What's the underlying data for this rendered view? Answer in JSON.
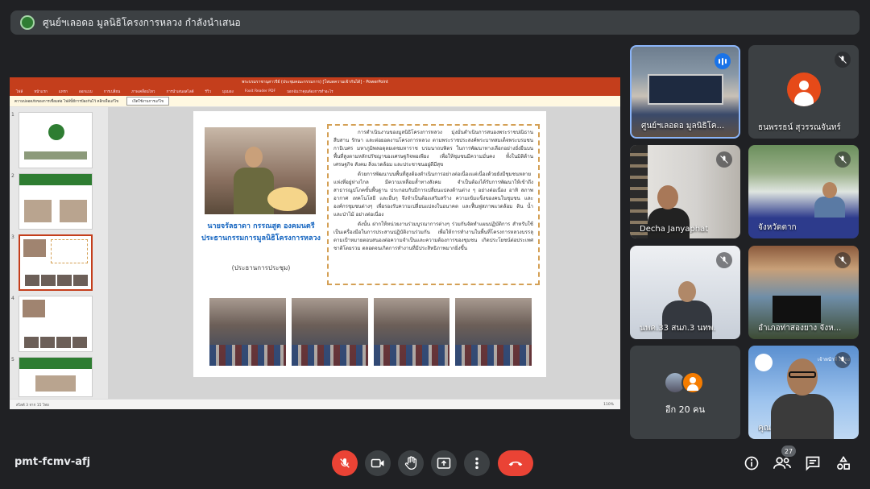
{
  "presenter_bar": {
    "text": "ศูนย์ฯเลอดอ มูลนิธิโครงการหลวง กำลังนำเสนอ"
  },
  "powerpoint": {
    "title": "พระบรมราชานุสาวรีย์ (ประชุมคณะกรรมการ) [โหมดความเข้ากันได้] - PowerPoint",
    "ribbon_tabs": [
      "ไฟล์",
      "หน้าแรก",
      "แทรก",
      "ออกแบบ",
      "การเปลี่ยน",
      "ภาพเคลื่อนไหว",
      "การนำเสนอสไลด์",
      "รีวิว",
      "มุมมอง",
      "Foxit Reader PDF",
      "บอกฉันว่าคุณต้องการทำอะไร"
    ],
    "message": "ความปลอดภัยของการเชื่อมต่อ  ไฟล์นี้มีการป้องกันไว้ คลิกเพื่อแก้ไข",
    "message_button": "เปิดใช้งานการแก้ไข",
    "thumb_numbers": [
      "1",
      "2",
      "3",
      "4",
      "5"
    ],
    "status_left": "สไลด์ 3 จาก 15   ไทย",
    "status_right": "110%",
    "slide": {
      "person_name": "นายจรัลธาดา กรรณสูต องคมนตรี ประธานกรรมการมูลนิธิโครงการหลวง",
      "caption": "(ประธานการประชุม)",
      "paragraphs": [
        "การดำเนินงานของมูลนิธิโครงการหลวง มุ่งมั่นดำเนินการสนองพระราชปณิธาน สืบสาน รักษา และต่อยอดงานโครงการหลวง ตามพระราชประสงค์พระบาทสมเด็จพระบรมชนกาธิเบศร มหาภูมิพลอดุลยเดชมหาราช บรมนาถบพิตร ในการพัฒนาทางเลือกอย่างยั่งยืนบนพื้นที่สูงตามหลักปรัชญาของเศรษฐกิจพอเพียง เพื่อให้ชุมชนมีความมั่นคง ทั้งในมิติด้านเศรษฐกิจ สังคม สิ่งแวดล้อม และประชาชนอยู่ดีมีสุข",
        "ด้วยการพัฒนาบนพื้นที่สูงต้องดำเนินการอย่างต่อเนื่องแต่เนื่องด้วยยังมีชุมชนหลายแห่งที่อยู่ห่างไกล มีความเหลื่อมล้ำทางสังคม จำเป็นต้องได้รับการพัฒนาให้เข้าถึงสาธารณูปโภคขั้นพื้นฐาน ประกอบกับมีการเปลี่ยนแปลงด้านต่าง ๆ อย่างต่อเนื่อง อาทิ สภาพอากาศ เทคโนโลยี และอื่นๆ จึงจำเป็นต้องเสริมสร้าง ความเข้มแข็งของคนในชุมชน และองค์กรชุมชนต่างๆ เพื่อรองรับความเปลี่ยนแปลงในอนาคต และฟื้นฟูสภาพแวดล้อม ดิน น้ำ และป่าไม้ อย่างต่อเนื่อง",
        "ดังนั้น ฝากให้หน่วยงานร่วมบูรณาการต่างๆ ร่วมกันจัดทำแผนปฏิบัติการ สำหรับใช้เป็นเครื่องมือในการประสานปฏิบัติงานร่วมกัน เพื่อให้การทำงานในพื้นที่โครงการหลวงบรรลุตามเป้าหมายตอบสนองต่อความจำเป็นและความต้องการของชุมชน เกิดประโยชน์ต่อประเทศชาติโดยรวม ตลอดจนเกิดการทำงานที่มีประสิทธิภาพมากยิ่งขึ้น"
      ]
    }
  },
  "participants": [
    {
      "name": "ศูนย์ฯเลอดอ มูลนิธิโค...",
      "state": "speaking"
    },
    {
      "name": "ธนพรรธน์ สุวรรณจันทร์",
      "state": "muted"
    },
    {
      "name": "Decha Janyaphat",
      "state": "muted"
    },
    {
      "name": "จังหวัดตาก",
      "state": "muted"
    },
    {
      "name": "นพค.33 สนภ.3 นทพ.",
      "state": "muted"
    },
    {
      "name": "อำเภอท่าสองยาง จังห...",
      "state": "muted"
    },
    {
      "name": "อีก 20 คน",
      "state": "more"
    },
    {
      "name": "คุณ",
      "state": "muted"
    }
  ],
  "khun_tile_text": "เจ้าหน้าที่ สยอง",
  "meeting_code": "pmt-fcmv-afj",
  "people_count": "27",
  "icons": [
    "mic-off-icon",
    "camera-icon",
    "raise-hand-icon",
    "present-icon",
    "more-icon",
    "hang-up-icon",
    "info-icon",
    "people-icon",
    "chat-icon",
    "activities-icon"
  ]
}
